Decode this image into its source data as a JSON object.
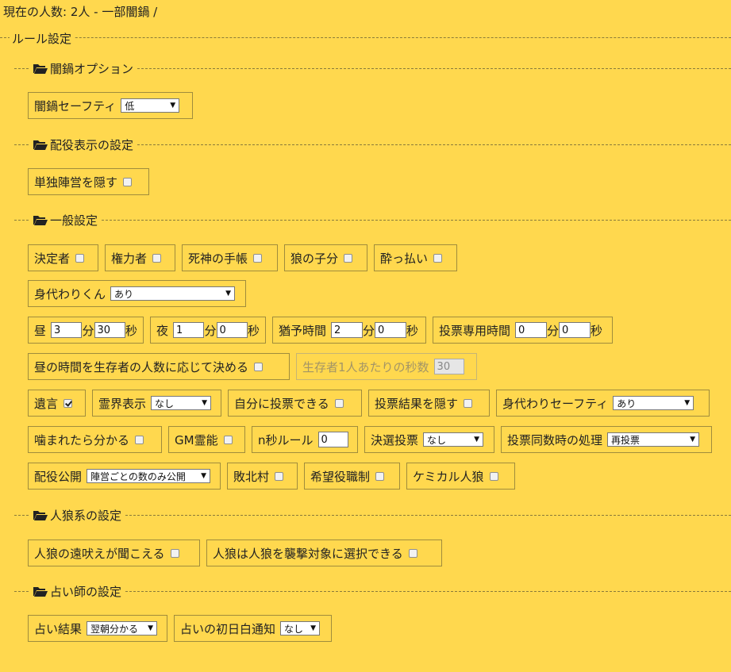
{
  "status": "現在の人数: 2人 - 一部闇鍋 /",
  "rules_legend": "ルール設定",
  "sections": {
    "yaminabe": "闇鍋オプション",
    "role_display": "配役表示の設定",
    "general": "一般設定",
    "werewolf": "人狼系の設定",
    "seer": "占い師の設定"
  },
  "yaminabe": {
    "safety_label": "闇鍋セーフティ",
    "safety_value": "低"
  },
  "role_display": {
    "hide_solo_label": "単独陣営を隠す"
  },
  "general": {
    "decider": "決定者",
    "authority": "権力者",
    "death_note": "死神の手帳",
    "wolf_cub": "狼の子分",
    "drunk": "酔っ払い",
    "scapegoat_label": "身代わりくん",
    "scapegoat_value": "あり",
    "day_label": "昼",
    "day_min": "3",
    "day_sec": "30",
    "night_label": "夜",
    "night_min": "1",
    "night_sec": "0",
    "grace_label": "猶予時間",
    "grace_min": "2",
    "grace_sec": "0",
    "vote_time_label": "投票専用時間",
    "vote_min": "0",
    "vote_sec": "0",
    "min_unit": "分",
    "sec_unit": "秒",
    "dynamic_day_label": "昼の時間を生存者の人数に応じて決める",
    "per_survivor_label": "生存者1人あたりの秒数",
    "per_survivor_value": "30",
    "will": "遺言",
    "spirit_label": "霊界表示",
    "spirit_value": "なし",
    "self_vote": "自分に投票できる",
    "hide_vote": "投票結果を隠す",
    "scapegoat_safety_label": "身代わりセーフティ",
    "scapegoat_safety_value": "あり",
    "bitten_know": "噛まれたら分かる",
    "gm_medium": "GM霊能",
    "n_sec_label": "n秒ルール",
    "n_sec_value": "0",
    "decisive_label": "決選投票",
    "decisive_value": "なし",
    "tie_label": "投票同数時の処理",
    "tie_value": "再投票",
    "role_public_label": "配役公開",
    "role_public_value": "陣営ごとの数のみ公開",
    "losing_village": "敗北村",
    "hope_role": "希望役職制",
    "chemical": "ケミカル人狼"
  },
  "werewolf": {
    "howl": "人狼の遠吠えが聞こえる",
    "wolf_target_wolf": "人狼は人狼を襲撃対象に選択できる"
  },
  "seer": {
    "result_label": "占い結果",
    "result_value": "翌朝分かる",
    "first_white_label": "占いの初日白通知",
    "first_white_value": "なし"
  }
}
